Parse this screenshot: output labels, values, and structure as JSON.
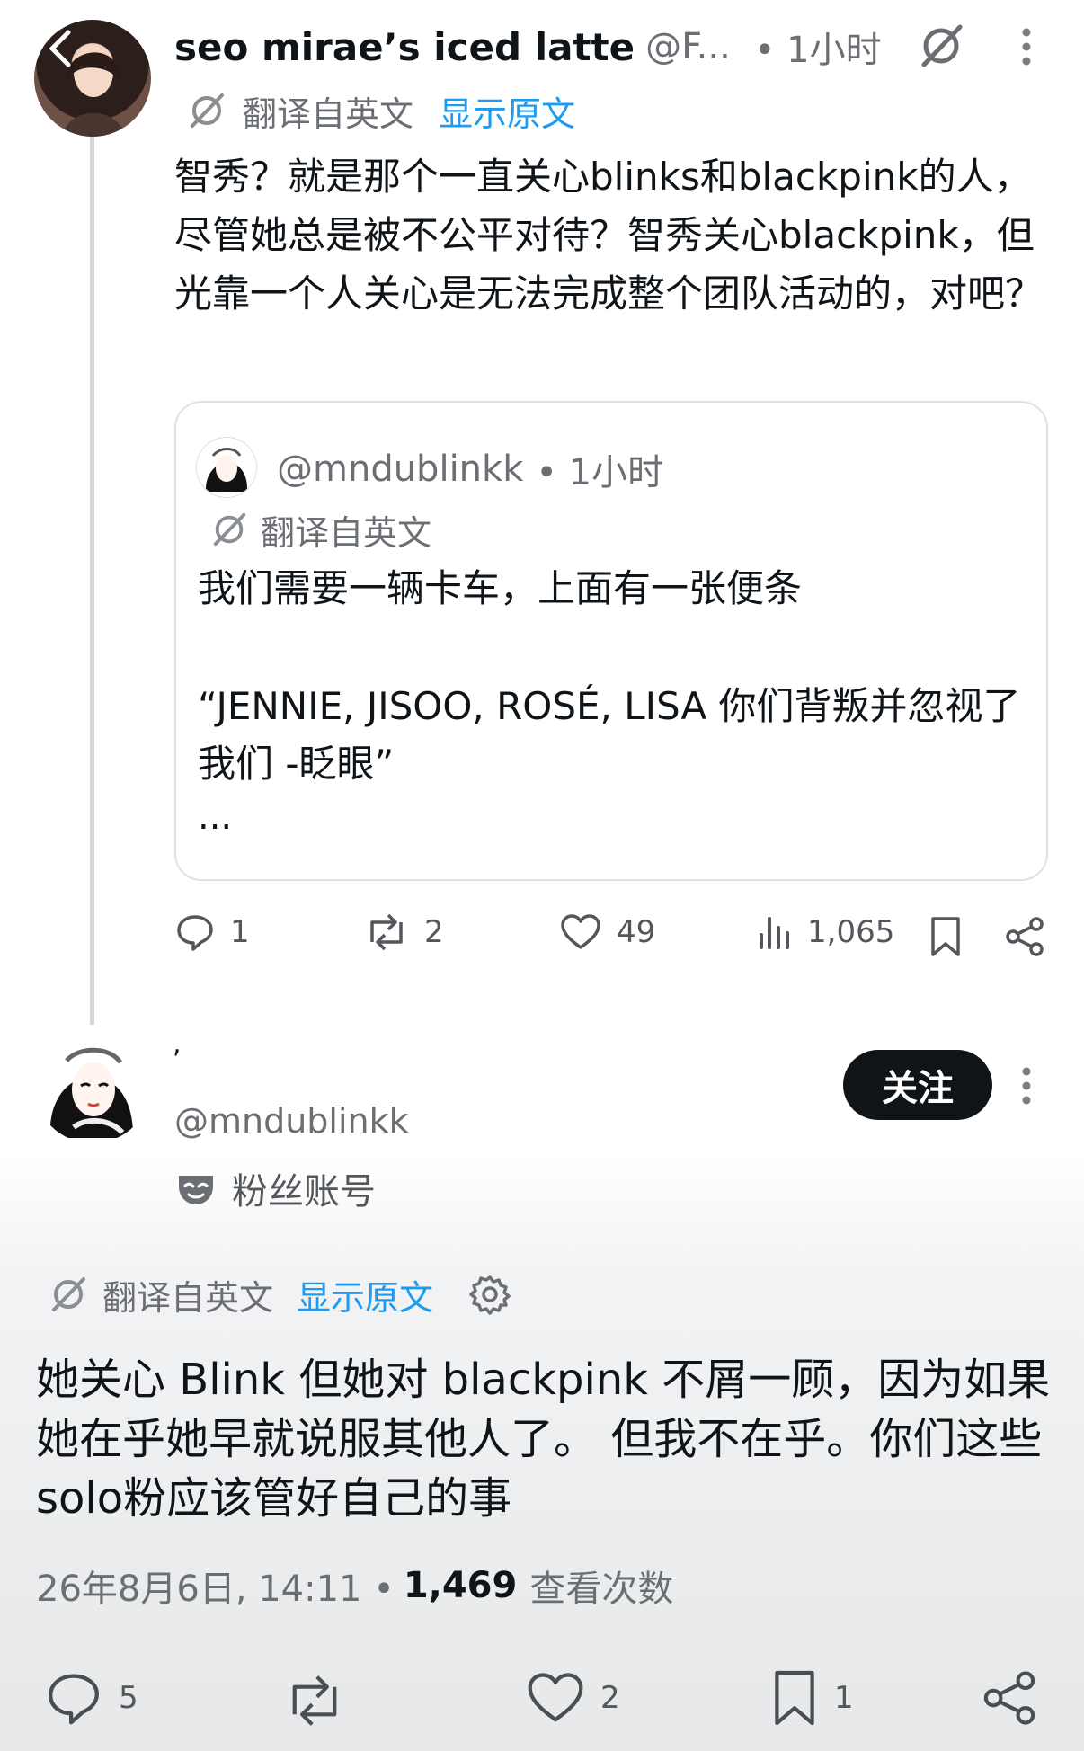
{
  "thread_post": {
    "author_name": "seo mirae’s iced latte",
    "author_handle": "@F...",
    "time": "• 1小时",
    "translate_label": "翻译自英文",
    "show_original": "显示原文",
    "body": "智秀？就是那个一直关心blinks和blackpink的人，尽管她总是被不公平对待？智秀关心blackpink，但光靠一个人关心是无法完成整个团队活动的，对吧？",
    "quote": {
      "handle": "@mndublinkk",
      "time": "• 1小时",
      "translate_label": "翻译自英文",
      "line1": "我们需要一辆卡车，上面有一张便条",
      "line2": "“JENNIE, JISOO, ROSÉ, LISA 你们背叛并忽视了我们 -眨眼”",
      "ellipsis": "..."
    },
    "stats": {
      "replies": "1",
      "reposts": "2",
      "likes": "49",
      "views": "1,065"
    }
  },
  "main_post": {
    "display_name": ",",
    "handle": "@mndublinkk",
    "follow_label": "关注",
    "badge_label": "粉丝账号",
    "translate_label": "翻译自英文",
    "show_original": "显示原文",
    "body": "她关心 Blink 但她对 blackpink 不屑一顾，因为如果她在乎她早就说服其他人了。 但我不在乎。你们这些solo粉应该管好自己的事",
    "date": "26年8月6日, 14:11 •",
    "views_count": "1,469",
    "views_label": "查看次数",
    "stats": {
      "replies": "5",
      "likes": "2",
      "bookmarks": "1"
    }
  },
  "icons": [
    "back-arrow-icon",
    "grok-icon",
    "more-icon",
    "reply-icon",
    "repost-icon",
    "like-icon",
    "views-icon",
    "bookmark-icon",
    "share-icon",
    "mask-icon",
    "gear-icon"
  ],
  "colors": {
    "link": "#1d9bf0",
    "text": "#0f1419",
    "muted": "#6b6f74",
    "follow_bg": "#0f1419"
  }
}
